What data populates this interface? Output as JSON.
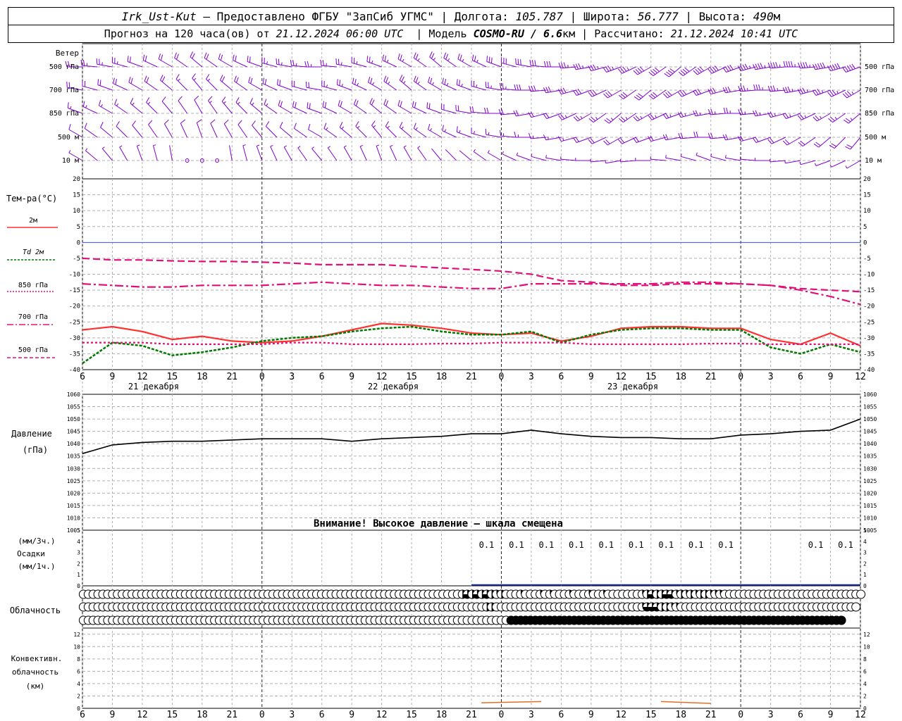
{
  "header": {
    "station": "Irk_Ust-Kut",
    "provided_by": "— Предоставлено ФГБУ \"ЗапСиб УГМС\"",
    "lon_label": "| Долгота:",
    "lon": "105.787",
    "lat_label": "| Широта:",
    "lat": "56.777",
    "alt_label": "| Высота:",
    "alt": "490",
    "alt_unit": "м",
    "forecast_label": "Прогноз на 120 часа(ов) от",
    "forecast_time": "21.12.2024 06:00 UTC",
    "model_label": "| Модель",
    "model": "COSMO-RU / 6.6",
    "model_unit": "км",
    "calc_label": "| Рассчитано:",
    "calc_time": "21.12.2024 10:41 UTC"
  },
  "panels": {
    "wind": {
      "title": "Ветер",
      "levels": [
        "500 гПа",
        "700 гПа",
        "850 гПа",
        "500 м",
        "10 м"
      ]
    },
    "temperature": {
      "title": "Тем-ра(°С)",
      "legend": [
        "2м",
        "Td 2м",
        "850 гПа",
        "700 гПа",
        "500 гПа"
      ]
    },
    "pressure": {
      "title": "Давление",
      "unit": "(гПа)",
      "warning": "Внимание! Высокое давление – шкала смещена"
    },
    "precip": {
      "label1": "(мм/3ч.)",
      "label2": "Осадки",
      "label3": "(мм/1ч.)"
    },
    "cloud": {
      "title": "Облачность"
    },
    "convective": {
      "label1": "Конвективн.",
      "label2": "облачность",
      "label3": "(км)"
    }
  },
  "time_axis": {
    "hour_labels": [
      "6",
      "9",
      "12",
      "15",
      "18",
      "21",
      "0",
      "3",
      "6",
      "9",
      "12",
      "15",
      "18",
      "21",
      "0",
      "3",
      "6",
      "9",
      "12",
      "15",
      "18",
      "21",
      "0",
      "3",
      "6",
      "9",
      "12"
    ],
    "day_labels": [
      "21 декабря",
      "22 декабря",
      "23 декабря"
    ]
  },
  "colors": {
    "wind": "#8000cc",
    "t2m": "#ff3030",
    "td2m": "#007a00",
    "t850": "#e0107a",
    "pressure": "#000000",
    "precip": "#1a2a8a",
    "conv": "#e07020",
    "zero_line": "#3050ff",
    "grid": "#b0b0b0"
  },
  "chart_data": {
    "type": "line",
    "x_hours_from_start": [
      0,
      3,
      6,
      9,
      12,
      15,
      18,
      21,
      24,
      27,
      30,
      33,
      36,
      39,
      42,
      45,
      48,
      51,
      54,
      57,
      60,
      63,
      66,
      69,
      72,
      75,
      78
    ],
    "temperature": {
      "ylim": [
        -40,
        20
      ],
      "yticks": [
        20,
        15,
        10,
        5,
        0,
        -5,
        -10,
        -15,
        -20,
        -25,
        -30,
        -35,
        -40
      ],
      "series": [
        {
          "name": "2м",
          "values": [
            -27.5,
            -26.5,
            -28,
            -30.5,
            -29.5,
            -31,
            -31.5,
            -31,
            -29.5,
            -27.5,
            -25.5,
            -26,
            -27,
            -28.5,
            -29,
            -28.5,
            -31,
            -29.5,
            -27,
            -26.5,
            -26.5,
            -27,
            -27,
            -30.5,
            -32,
            -28.5,
            -32.5
          ]
        },
        {
          "name": "Td 2м",
          "values": [
            -38,
            -31.5,
            -32.5,
            -35.5,
            -34.5,
            -33,
            -31,
            -30,
            -29.5,
            -28,
            -27,
            -26.5,
            -28,
            -29,
            -29,
            -28,
            -31.5,
            -29,
            -27.5,
            -27,
            -27,
            -27.5,
            -27.5,
            -33,
            -35,
            -32,
            -34.5
          ]
        },
        {
          "name": "850 гПа",
          "values": [
            -31.5,
            -31.5,
            -31.5,
            -32,
            -32,
            -32,
            -32,
            -31.5,
            -31.5,
            -32,
            -32,
            -32,
            -31.8,
            -31.8,
            -31.5,
            -31.5,
            -31.5,
            -32,
            -32,
            -32,
            -32,
            -31.8,
            -31.8,
            -32,
            -32,
            -32,
            -32
          ]
        },
        {
          "name": "700 гПа",
          "values": [
            -13,
            -13.5,
            -14,
            -14,
            -13.5,
            -13.5,
            -13.5,
            -13,
            -12.5,
            -13,
            -13.5,
            -13.5,
            -14,
            -14.5,
            -14.5,
            -13,
            -13,
            -13,
            -13,
            -13,
            -12.5,
            -12.5,
            -13,
            -13.5,
            -15,
            -17,
            -19.5
          ]
        },
        {
          "name": "500 гПа",
          "values": [
            -5,
            -5.5,
            -5.5,
            -5.8,
            -6,
            -6,
            -6.2,
            -6.5,
            -7,
            -7,
            -7,
            -7.5,
            -8,
            -8.5,
            -9,
            -10,
            -12,
            -12.5,
            -13.5,
            -13.5,
            -13,
            -13,
            -13,
            -13.5,
            -14.5,
            -15,
            -15.5
          ]
        }
      ]
    },
    "pressure": {
      "ylim": [
        1005,
        1060
      ],
      "yticks": [
        1060,
        1055,
        1050,
        1045,
        1040,
        1035,
        1030,
        1025,
        1020,
        1015,
        1010,
        1005
      ],
      "values": [
        1036,
        1039.5,
        1040.5,
        1041,
        1041,
        1041.5,
        1042,
        1042,
        1042,
        1041,
        1042,
        1042.5,
        1043,
        1044,
        1044,
        1045.5,
        1044,
        1043,
        1042.5,
        1042.5,
        1042,
        1042,
        1043.5,
        1044,
        1045,
        1045.5,
        1050
      ]
    },
    "precip": {
      "ylim": [
        0,
        5
      ],
      "labels_x_hours": [
        42,
        45,
        48,
        51,
        54,
        57,
        60,
        63,
        66,
        69,
        72,
        75,
        78
      ],
      "labels": [
        "0.1",
        "0.1",
        "0.1",
        "0.1",
        "0.1",
        "0.1",
        "0.1",
        "0.1",
        "0.1",
        "",
        "",
        "0.1",
        "0.1"
      ]
    },
    "cloud": {
      "rows": 3,
      "rows_fraction": [
        [
          0,
          0,
          0,
          0,
          0,
          0,
          0,
          0,
          0,
          0,
          0,
          0,
          0,
          0,
          0,
          0,
          0,
          0,
          0,
          0,
          0,
          0,
          0,
          0,
          0,
          0,
          0,
          0,
          0,
          0,
          0,
          0,
          0,
          0,
          0,
          0,
          0,
          0,
          0,
          0,
          0,
          0,
          0,
          0,
          0,
          0,
          0,
          0,
          0,
          0,
          0,
          0,
          0,
          0,
          0,
          0,
          0,
          0,
          0,
          0,
          0,
          0,
          0,
          0,
          0,
          0,
          0,
          0,
          0,
          0,
          0,
          0,
          0,
          0,
          0,
          0,
          0,
          0,
          0.5,
          0.75,
          0.5,
          0.75,
          0.5,
          0.75,
          0.5,
          0.25,
          0.5,
          0,
          0,
          0,
          0.25,
          0,
          0,
          0,
          0.25,
          0,
          0.25,
          0,
          0,
          0,
          0.25,
          0,
          0,
          0,
          0.25,
          0,
          0,
          0.25,
          0,
          0,
          0,
          0,
          0,
          0,
          0,
          0.25,
          0.5,
          0.75,
          0.5,
          0.5,
          0.75,
          0.75,
          0.25,
          0.5,
          0.25,
          0.5,
          0.25,
          0.5,
          0.5,
          0.25,
          0.25,
          0.25,
          0,
          0,
          0,
          0,
          0,
          0,
          0,
          0,
          0,
          0,
          0,
          0,
          0,
          0,
          0,
          0,
          0,
          0,
          0,
          0,
          0,
          0,
          0,
          0,
          0,
          0,
          0,
          0,
          0
        ],
        [
          0,
          0,
          0,
          0,
          0,
          0,
          0,
          0,
          0,
          0,
          0,
          0,
          0,
          0,
          0,
          0,
          0,
          0,
          0,
          0,
          0,
          0,
          0,
          0,
          0,
          0,
          0,
          0,
          0,
          0,
          0,
          0,
          0,
          0,
          0,
          0,
          0,
          0,
          0,
          0,
          0,
          0,
          0,
          0,
          0,
          0,
          0,
          0,
          0,
          0,
          0,
          0,
          0,
          0,
          0,
          0,
          0,
          0,
          0,
          0,
          0,
          0,
          0,
          0,
          0,
          0,
          0,
          0,
          0,
          0,
          0,
          0,
          0,
          0,
          0,
          0,
          0,
          0,
          0,
          0,
          0,
          0,
          0,
          0.5,
          0.5,
          0,
          0,
          0,
          0,
          0,
          0,
          0,
          0,
          0,
          0,
          0,
          0,
          0,
          0,
          0,
          0,
          0,
          0,
          0,
          0,
          0,
          0,
          0,
          0,
          0,
          0,
          0,
          0,
          0,
          0,
          0.25,
          0.75,
          0.75,
          0.75,
          0.5,
          0.5,
          0.25,
          0.25,
          0,
          0,
          0,
          0,
          0,
          0,
          0,
          0,
          0,
          0,
          0,
          0,
          0,
          0,
          0,
          0,
          0,
          0,
          0,
          0,
          0,
          0,
          0,
          0,
          0,
          0,
          0,
          0,
          0,
          0,
          0,
          0,
          0,
          0,
          0,
          0,
          0
        ],
        [
          0,
          0,
          0,
          0,
          0,
          0,
          0,
          0,
          0,
          0,
          0,
          0,
          0,
          0,
          0,
          0,
          0,
          0,
          0,
          0,
          0,
          0,
          0,
          0,
          0,
          0,
          0,
          0,
          0,
          0,
          0,
          0,
          0,
          0,
          0,
          0,
          0,
          0,
          0,
          0,
          0,
          0,
          0,
          0,
          0,
          0,
          0,
          0,
          0,
          0,
          0,
          0,
          0,
          0,
          0,
          0,
          0,
          0,
          0,
          0,
          0,
          0,
          0,
          0,
          0,
          0,
          0,
          0,
          0,
          0,
          0,
          0,
          0,
          0,
          0,
          0,
          0,
          0,
          0,
          0,
          0,
          0,
          0,
          0,
          0,
          0,
          0,
          0,
          1,
          1,
          1,
          1,
          1,
          1,
          1,
          1,
          1,
          1,
          1,
          1,
          1,
          1,
          1,
          1,
          1,
          1,
          1,
          1,
          1,
          1,
          1,
          1,
          1,
          1,
          1,
          1,
          1,
          1,
          1,
          1,
          1,
          1,
          1,
          1,
          1,
          1,
          1,
          1,
          1,
          1,
          1,
          1,
          1,
          1,
          1,
          1,
          1,
          1,
          1,
          1,
          1,
          1,
          1,
          1,
          1,
          1,
          1,
          1,
          1,
          1,
          1,
          1,
          1,
          1,
          1,
          1,
          1
        ]
      ]
    },
    "convective": {
      "ylim": [
        0,
        13
      ],
      "yticks": [
        12,
        10,
        8,
        6,
        4,
        2,
        0
      ],
      "segments": [
        {
          "x_hours": [
            40,
            46
          ],
          "height_km": [
            0.9,
            1.1
          ]
        },
        {
          "x_hours": [
            58,
            63
          ],
          "height_km": [
            1.1,
            0.8
          ]
        }
      ]
    },
    "wind_barbs": {
      "levels": [
        "500 гПа",
        "700 гПа",
        "850 гПа",
        "500 м",
        "10 м"
      ],
      "direction_deg": [
        [
          270,
          280,
          290,
          300,
          310,
          300,
          290,
          280,
          270,
          280,
          290,
          300,
          310,
          300,
          290,
          280,
          270,
          260,
          250,
          240,
          230,
          240,
          250,
          260,
          270,
          260,
          250
        ],
        [
          280,
          290,
          300,
          310,
          320,
          310,
          300,
          290,
          280,
          290,
          300,
          310,
          300,
          290,
          280,
          270,
          260,
          250,
          240,
          230,
          240,
          250,
          260,
          270,
          260,
          250,
          240
        ],
        [
          290,
          300,
          310,
          320,
          330,
          320,
          310,
          300,
          290,
          300,
          310,
          300,
          290,
          280,
          270,
          260,
          250,
          240,
          230,
          240,
          250,
          260,
          270,
          260,
          250,
          240,
          230
        ],
        [
          300,
          310,
          320,
          330,
          340,
          330,
          320,
          310,
          300,
          310,
          320,
          310,
          300,
          290,
          280,
          270,
          260,
          250,
          240,
          250,
          260,
          270,
          260,
          250,
          240,
          230,
          220
        ],
        [
          300,
          320,
          340,
          350,
          0,
          350,
          340,
          330,
          320,
          330,
          340,
          330,
          320,
          310,
          300,
          290,
          280,
          270,
          260,
          270,
          280,
          290,
          280,
          270,
          260,
          250,
          240
        ]
      ],
      "speed_ms": [
        [
          12,
          12,
          11,
          10,
          10,
          10,
          11,
          12,
          12,
          12,
          12,
          13,
          13,
          13,
          14,
          15,
          16,
          17,
          18,
          19,
          20,
          20,
          21,
          22,
          23,
          24,
          25
        ],
        [
          10,
          10,
          9,
          9,
          8,
          9,
          10,
          11,
          11,
          12,
          12,
          12,
          12,
          13,
          13,
          14,
          14,
          15,
          15,
          15,
          16,
          16,
          16,
          17,
          17,
          17,
          18
        ],
        [
          7,
          7,
          7,
          6,
          6,
          7,
          8,
          9,
          9,
          9,
          10,
          10,
          10,
          10,
          11,
          11,
          11,
          12,
          12,
          12,
          12,
          12,
          12,
          13,
          13,
          13,
          13
        ],
        [
          5,
          5,
          5,
          4,
          4,
          5,
          6,
          6,
          6,
          7,
          7,
          7,
          7,
          8,
          8,
          8,
          8,
          9,
          9,
          9,
          9,
          9,
          9,
          10,
          10,
          10,
          10
        ],
        [
          2,
          2,
          2,
          1,
          0,
          1,
          2,
          2,
          2,
          2,
          2,
          2,
          1,
          1,
          2,
          2,
          2,
          2,
          2,
          2,
          2,
          2,
          2,
          3,
          3,
          3,
          3
        ]
      ]
    }
  }
}
